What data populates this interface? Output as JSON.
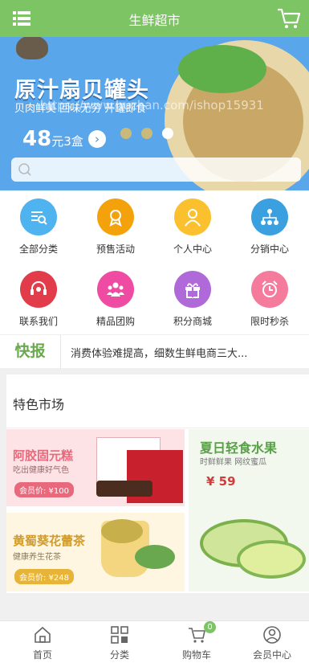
{
  "header": {
    "title": "生鲜超市"
  },
  "banner": {
    "headline": "原汁扇贝罐头",
    "subline": "贝肉鲜美 回味无穷 开罐即食",
    "watermark": "https://www.huzhan.com/ishop15931",
    "price_num": "48",
    "price_unit": "元3盒",
    "arrow": "›"
  },
  "search": {
    "placeholder": ""
  },
  "menu": [
    {
      "label": "全部分类",
      "color": "#4fb3ef",
      "icon": "search-list-icon"
    },
    {
      "label": "预售活动",
      "color": "#f4a20c",
      "icon": "medal-icon"
    },
    {
      "label": "个人中心",
      "color": "#fbc02d",
      "icon": "user-icon"
    },
    {
      "label": "分销中心",
      "color": "#3aa0e0",
      "icon": "network-icon"
    },
    {
      "label": "联系我们",
      "color": "#e23c4b",
      "icon": "headset-icon"
    },
    {
      "label": "精品团购",
      "color": "#f04ba3",
      "icon": "group-icon"
    },
    {
      "label": "积分商城",
      "color": "#b069d8",
      "icon": "gift-icon"
    },
    {
      "label": "限时秒杀",
      "color": "#f57b9c",
      "icon": "alarm-icon"
    }
  ],
  "news": {
    "label": "快报",
    "text": "消费体验难提高，细数生鲜电商三大..."
  },
  "featured": {
    "title": "特色市场",
    "tiles": [
      {
        "name": "阿胶固元糕",
        "desc": "吃出健康好气色",
        "price": "会员价: ¥100"
      },
      {
        "name": "黄蜀葵花蕾茶",
        "desc": "健康养生花茶",
        "price": "会员价: ¥248"
      },
      {
        "name": "夏日轻食水果",
        "desc": "时鲜鲜果 网纹蜜瓜",
        "price": "¥ 59"
      }
    ]
  },
  "tabbar": {
    "items": [
      {
        "label": "首页"
      },
      {
        "label": "分类"
      },
      {
        "label": "购物车",
        "badge": "0"
      },
      {
        "label": "会员中心"
      }
    ]
  }
}
